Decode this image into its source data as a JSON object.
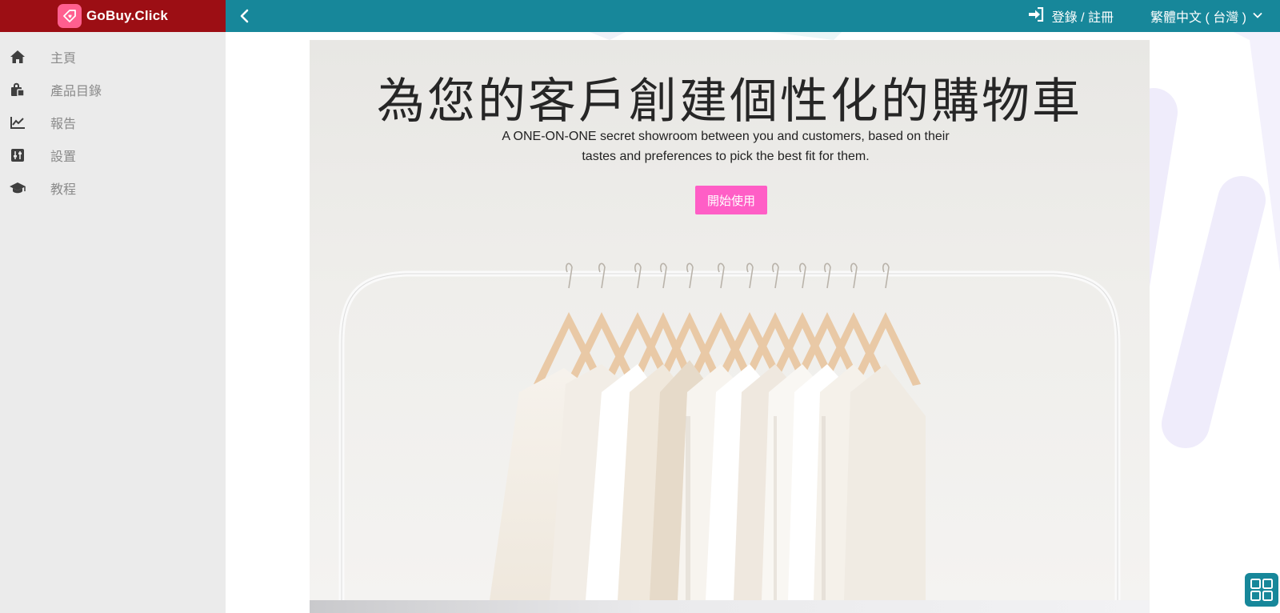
{
  "brand": {
    "name": "GoBuy.Click",
    "logo_icon": "tag-heart-icon"
  },
  "colors": {
    "brand_red": "#9c0e14",
    "topbar_teal": "#17879a",
    "cta_pink": "#ff5ec6",
    "sidebar_bg": "#ebebeb"
  },
  "sidebar": {
    "items": [
      {
        "label": "主頁",
        "icon": "home-icon"
      },
      {
        "label": "產品目錄",
        "icon": "shopping-bag-icon"
      },
      {
        "label": "報告",
        "icon": "line-chart-icon"
      },
      {
        "label": "設置",
        "icon": "sliders-icon"
      },
      {
        "label": "教程",
        "icon": "graduation-cap-icon"
      }
    ]
  },
  "topbar": {
    "back_icon": "chevron-left-icon",
    "login_label": "登錄 / 註冊",
    "login_icon": "sign-in-icon",
    "language": "繁體中文 ( 台灣 )",
    "language_icon": "chevron-down-icon"
  },
  "hero": {
    "title": "為您的客戶創建個性化的購物車",
    "subtitle": "A ONE-ON-ONE secret showroom between you and customers, based on their tastes and preferences to pick the best fit for them.",
    "cta_label": "開始使用"
  },
  "floating": {
    "grid_icon": "grid-icon"
  }
}
